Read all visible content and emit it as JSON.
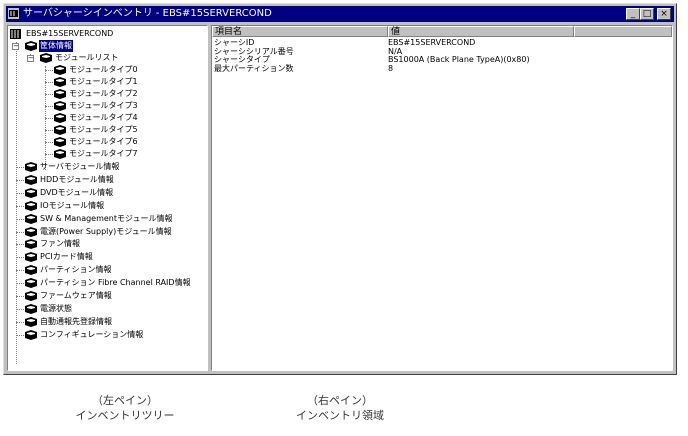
{
  "window": {
    "title": "サーバシャーシインベントリ - EBS#15SERVERCOND",
    "minimize_glyph": "_",
    "maximize_glyph": "□",
    "close_glyph": "×"
  },
  "tree": {
    "root": "EBS#15SERVERCOND",
    "env": "筐体情報",
    "module_list": "モジュールリスト",
    "module_types": [
      "モジュールタイプ0",
      "モジュールタイプ1",
      "モジュールタイプ2",
      "モジュールタイプ3",
      "モジュールタイプ4",
      "モジュールタイプ5",
      "モジュールタイプ6",
      "モジュールタイプ7"
    ],
    "items": [
      "サーバモジュール情報",
      "HDDモジュール情報",
      "DVDモジュール情報",
      "IOモジュール情報",
      "SW & Managementモジュール情報",
      "電源(Power Supply)モジュール情報",
      "ファン情報",
      "PCIカード情報",
      "パーティション情報",
      "パーティション Fibre Channel RAID情報",
      "ファームウェア情報",
      "電源状態",
      "自動通報先登録情報",
      "コンフィギュレーション情報"
    ]
  },
  "grid": {
    "col_name": "項目名",
    "col_value": "値",
    "rows": [
      {
        "name": "シャーシID",
        "value": "EBS#15SERVERCOND"
      },
      {
        "name": "シャーシシリアル番号",
        "value": "N/A"
      },
      {
        "name": "シャーシタイプ",
        "value": "BS1000A (Back Plane TypeA)(0x80)"
      },
      {
        "name": "最大パーティション数",
        "value": "8"
      }
    ]
  },
  "captions": {
    "left_1": "（左ペイン）",
    "left_2": "インベントリツリー",
    "right_1": "（右ペイン）",
    "right_2": "インベントリ領域"
  }
}
